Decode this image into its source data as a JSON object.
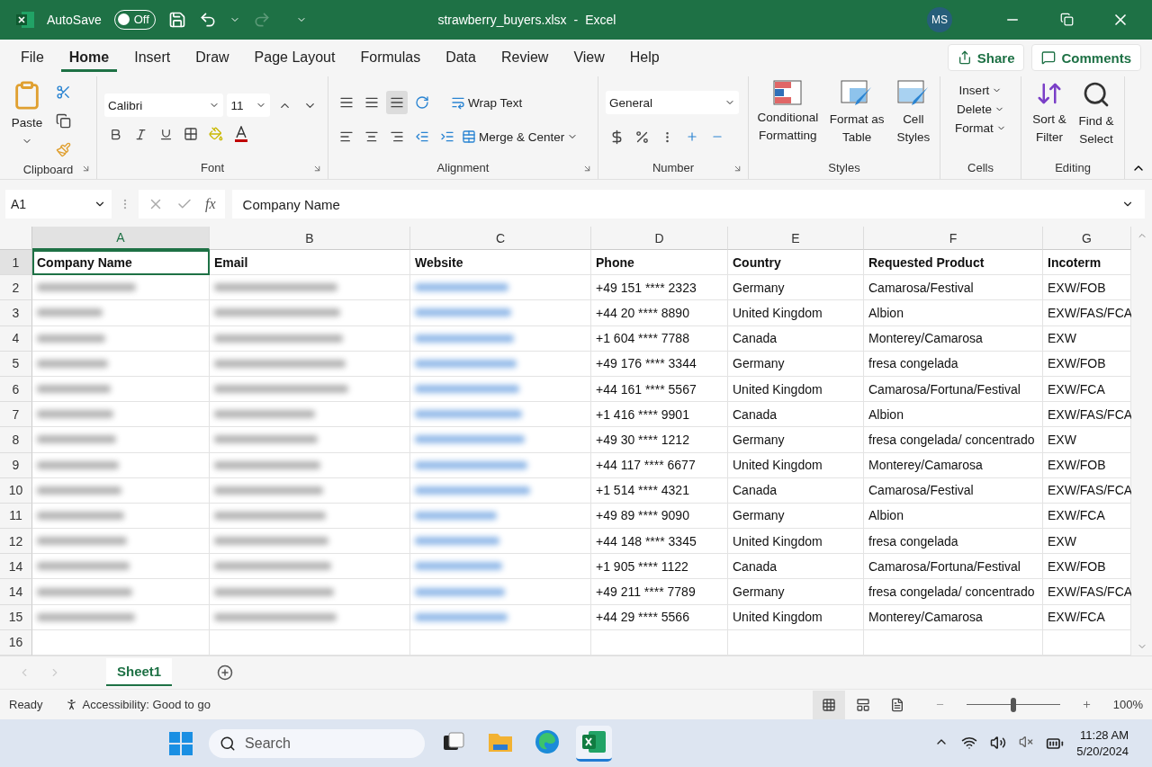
{
  "title_bar": {
    "autosave_label": "AutoSave",
    "autosave": {
      "on": false,
      "label": "Off"
    },
    "file_name": "strawberry_buyers.xlsx",
    "separator": "-",
    "app_name": "Excel",
    "avatar": "MS"
  },
  "menu_tabs": [
    {
      "label": "File",
      "selected": false
    },
    {
      "label": "Home",
      "selected": true
    },
    {
      "label": "Insert",
      "selected": false
    },
    {
      "label": "Draw",
      "selected": false
    },
    {
      "label": "Page Layout",
      "selected": false
    },
    {
      "label": "Formulas",
      "selected": false
    },
    {
      "label": "Data",
      "selected": false
    },
    {
      "label": "Review",
      "selected": false
    },
    {
      "label": "View",
      "selected": false
    },
    {
      "label": "Help",
      "selected": false
    }
  ],
  "share": "Share",
  "comments": "Comments",
  "ribbon": {
    "clipboard": {
      "label": "Clipboard",
      "paste": "Paste"
    },
    "font": {
      "label": "Font",
      "font_name": "Calibri",
      "font_size": "11"
    },
    "alignment": {
      "label": "Alignment",
      "vertical_align": [
        {
          "selected": false
        },
        {
          "selected": false
        },
        {
          "selected": true
        }
      ],
      "wrap_text": "Wrap Text",
      "merge": "Merge & Center"
    },
    "number": {
      "label": "Number",
      "format": "General"
    },
    "styles": {
      "label": "Styles",
      "buttons": [
        {
          "kind": "conditional",
          "label": "Conditional Formatting"
        },
        {
          "kind": "table",
          "label": "Format as Table"
        },
        {
          "kind": "cellstyles",
          "label": "Cell Styles"
        }
      ]
    },
    "cells": {
      "label": "Cells",
      "items": [
        "Insert",
        "Delete",
        "Format"
      ]
    },
    "editing": {
      "label": "Editing",
      "buttons": [
        {
          "kind": "sort",
          "label": "Sort & Filter"
        },
        {
          "kind": "find",
          "label": "Find & Select"
        }
      ]
    }
  },
  "formula_bar": {
    "name_box": "A1",
    "function_label": "fx",
    "value": "Company Name"
  },
  "columns": [
    {
      "letter": "A",
      "selected": true
    },
    {
      "letter": "B",
      "selected": false
    },
    {
      "letter": "C",
      "selected": false
    },
    {
      "letter": "D",
      "selected": false
    },
    {
      "letter": "E",
      "selected": false
    },
    {
      "letter": "F",
      "selected": false
    },
    {
      "letter": "G",
      "selected": false
    }
  ],
  "header_row": {
    "number": "1",
    "cells": [
      "Company Name",
      "Email",
      "Website",
      "Phone",
      "Country",
      "Requested Product",
      "Incoterm"
    ]
  },
  "rows": [
    {
      "number": "2",
      "blurred": true,
      "cells": [
        "+49 151 **** 2323",
        "Germany",
        "Camarosa/Festival",
        "EXW/FOB"
      ]
    },
    {
      "number": "3",
      "blurred": true,
      "cells": [
        "+44 20 **** 8890",
        "United Kingdom",
        "Albion",
        "EXW/FAS/FCA"
      ]
    },
    {
      "number": "4",
      "blurred": true,
      "cells": [
        "+1 604 **** 7788",
        "Canada",
        "Monterey/Camarosa",
        "EXW"
      ]
    },
    {
      "number": "5",
      "blurred": true,
      "cells": [
        "+49 176 **** 3344",
        "Germany",
        "fresa congelada",
        "EXW/FOB"
      ]
    },
    {
      "number": "6",
      "blurred": true,
      "cells": [
        "+44 161 **** 5567",
        "United Kingdom",
        "Camarosa/Fortuna/Festival",
        "EXW/FCA"
      ]
    },
    {
      "number": "7",
      "blurred": true,
      "cells": [
        "+1 416 **** 9901",
        "Canada",
        "Albion",
        "EXW/FAS/FCA"
      ]
    },
    {
      "number": "8",
      "blurred": true,
      "cells": [
        "+49 30 **** 1212",
        "Germany",
        "fresa congelada/ concentrado",
        "EXW"
      ]
    },
    {
      "number": "9",
      "blurred": true,
      "cells": [
        "+44 117 **** 6677",
        "United Kingdom",
        "Monterey/Camarosa",
        "EXW/FOB"
      ]
    },
    {
      "number": "10",
      "blurred": true,
      "cells": [
        "+1 514 **** 4321",
        "Canada",
        "Camarosa/Festival",
        "EXW/FAS/FCA"
      ]
    },
    {
      "number": "11",
      "blurred": true,
      "cells": [
        "+49 89 **** 9090",
        "Germany",
        "Albion",
        "EXW/FCA"
      ]
    },
    {
      "number": "12",
      "blurred": true,
      "cells": [
        "+44 148 **** 3345",
        "United Kingdom",
        "fresa congelada",
        "EXW"
      ]
    },
    {
      "number": "14",
      "blurred": true,
      "cells": [
        "+1 905 **** 1122",
        "Canada",
        "Camarosa/Fortuna/Festival",
        "EXW/FOB"
      ]
    },
    {
      "number": "14",
      "blurred": true,
      "cells": [
        "+49 211 **** 7789",
        "Germany",
        "fresa congelada/ concentrado",
        "EXW/FAS/FCA"
      ]
    },
    {
      "number": "15",
      "blurred": true,
      "cells": [
        "+44 29 **** 5566",
        "United Kingdom",
        "Monterey/Camarosa",
        "EXW/FCA"
      ]
    },
    {
      "number": "16",
      "blurred": false,
      "cells": []
    }
  ],
  "sheet_tabs": [
    {
      "label": "Sheet1",
      "selected": true
    }
  ],
  "status_bar": {
    "ready": "Ready",
    "accessibility": "Accessibility: Good to go",
    "views": [
      {
        "kind": "normal",
        "selected": true
      },
      {
        "kind": "layout",
        "selected": false
      },
      {
        "kind": "break",
        "selected": false
      }
    ],
    "zoom": {
      "level": 0.5,
      "label": "100%"
    }
  },
  "taskbar": {
    "search_placeholder": "Search",
    "apps": [
      {
        "kind": "taskview",
        "selected": false
      },
      {
        "kind": "files",
        "selected": false
      },
      {
        "kind": "edge",
        "selected": false
      },
      {
        "kind": "excel",
        "selected": true
      }
    ],
    "time": "11:28 AM",
    "date": "5/20/2024"
  }
}
